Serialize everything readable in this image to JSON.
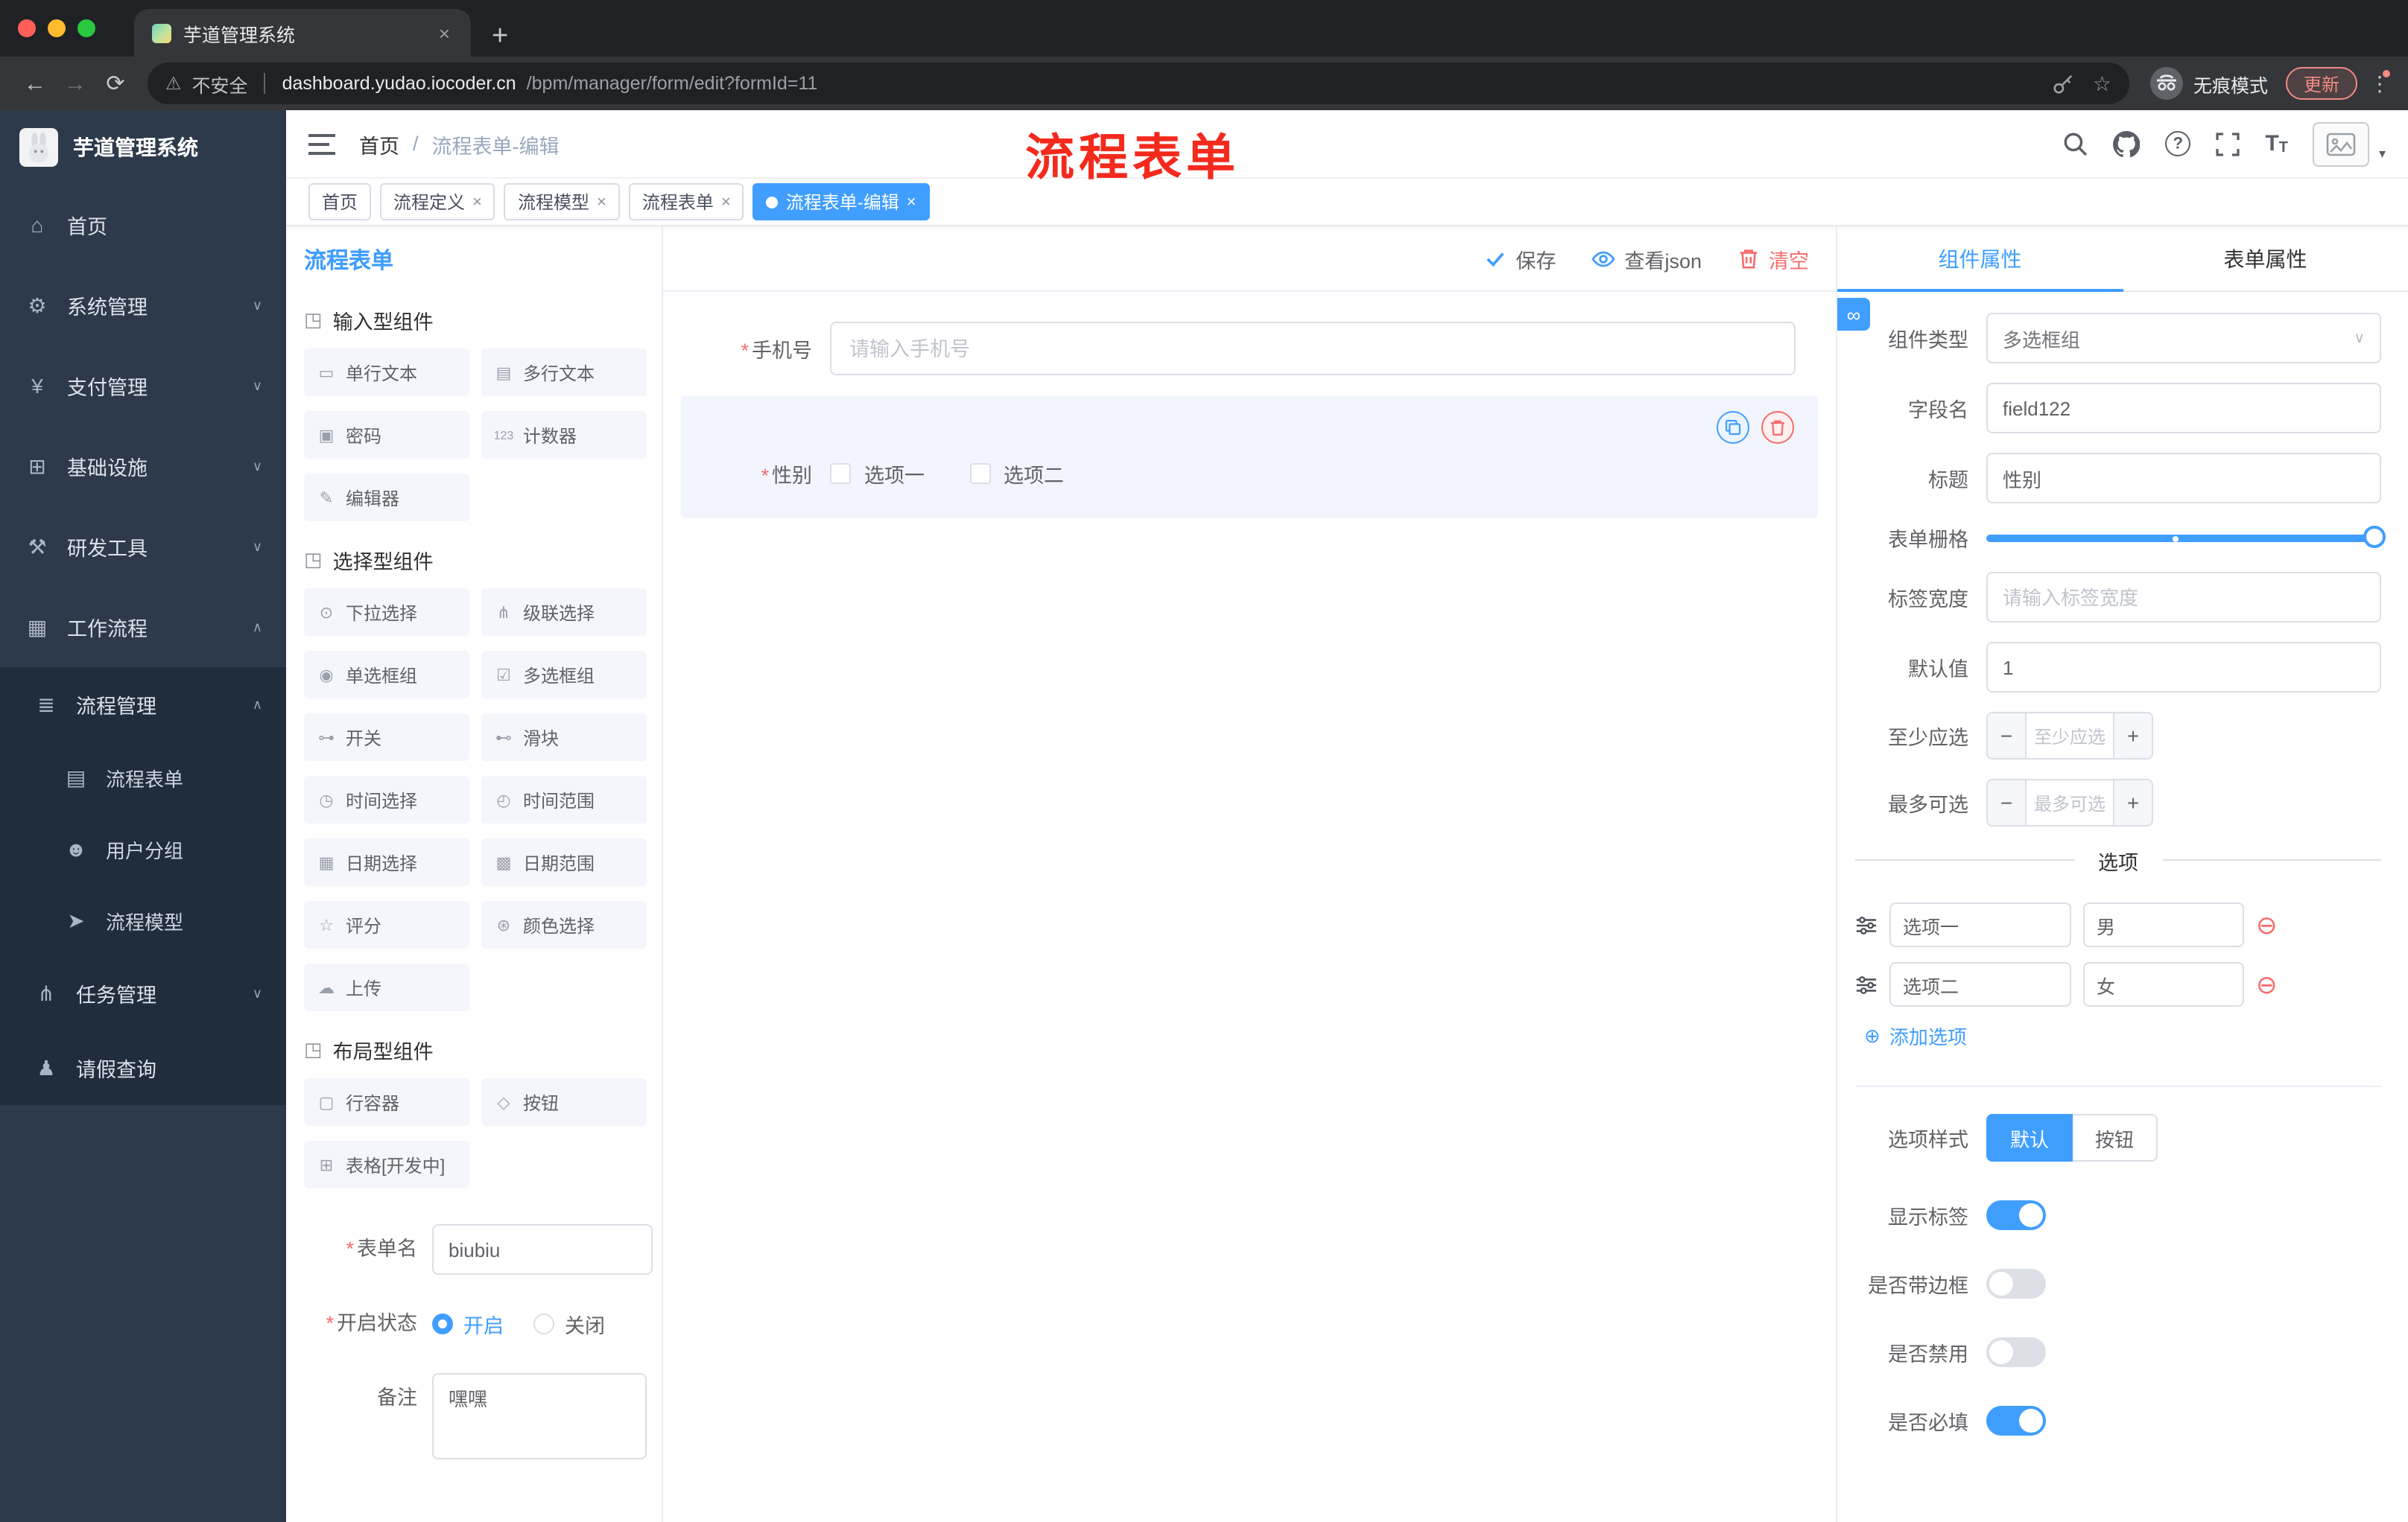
{
  "browser": {
    "tab_title": "芋道管理系统",
    "security_label": "不安全",
    "url_domain": "dashboard.yudao.iocoder.cn",
    "url_path": "/bpm/manager/form/edit?formId=11",
    "incognito_label": "无痕模式",
    "update_label": "更新"
  },
  "icons": {
    "back": "←",
    "forward": "→",
    "reload": "⟳",
    "warning": "⚠",
    "star": "☆",
    "plus": "+",
    "close": "×",
    "dot-menu": "⋮",
    "home": "⌂",
    "gear": "⚙",
    "yen": "¥",
    "infra": "⊞",
    "tools": "⚒",
    "workflow": "▦",
    "process-list": "≣",
    "doc": "▤",
    "chat": "☻",
    "send": "➤",
    "tree": "⋔",
    "person": "♟",
    "chevron-down": "∨",
    "chevron-up": "∧",
    "caret-down": "▾",
    "select-arrow": "∨",
    "group": "◳",
    "chip-single-line": "▭",
    "chip-multi-line": "▤",
    "chip-password": "▣",
    "chip-counter": "123",
    "chip-editor": "✎",
    "chip-select": "⊙",
    "chip-cascader": "⋔",
    "chip-radio": "◉",
    "chip-checkbox": "☑",
    "chip-switch": "⊶",
    "chip-slider": "⊷",
    "chip-time": "◷",
    "chip-time-range": "◴",
    "chip-date": "▦",
    "chip-date-range": "▩",
    "chip-rate": "☆",
    "chip-color": "⊛",
    "chip-upload": "☁",
    "chip-row": "▢",
    "chip-button": "◇",
    "chip-table": "⊞",
    "plus-circle": "⊕",
    "minus-circle": "⊖",
    "link": "∞"
  },
  "sidebar": {
    "logo_title": "芋道管理系统",
    "items": [
      {
        "label": "首页"
      },
      {
        "label": "系统管理"
      },
      {
        "label": "支付管理"
      },
      {
        "label": "基础设施"
      },
      {
        "label": "研发工具"
      },
      {
        "label": "工作流程"
      },
      {
        "label": "流程管理"
      },
      {
        "label": "流程表单"
      },
      {
        "label": "用户分组"
      },
      {
        "label": "流程模型"
      },
      {
        "label": "任务管理"
      },
      {
        "label": "请假查询"
      }
    ]
  },
  "header": {
    "breadcrumb_home": "首页",
    "breadcrumb_separator": "/",
    "breadcrumb_current": "流程表单-编辑",
    "annotation": "流程表单"
  },
  "tags": [
    {
      "label": "首页"
    },
    {
      "label": "流程定义"
    },
    {
      "label": "流程模型"
    },
    {
      "label": "流程表单"
    },
    {
      "label": "流程表单-编辑"
    }
  ],
  "designer": {
    "title": "流程表单",
    "save_label": "保存",
    "view_json_label": "查看json",
    "clear_label": "清空",
    "groups": [
      {
        "title": "输入型组件",
        "items": [
          "单行文本",
          "多行文本",
          "密码",
          "计数器",
          "编辑器"
        ]
      },
      {
        "title": "选择型组件",
        "items": [
          "下拉选择",
          "级联选择",
          "单选框组",
          "多选框组",
          "开关",
          "滑块",
          "时间选择",
          "时间范围",
          "日期选择",
          "日期范围",
          "评分",
          "颜色选择",
          "上传"
        ]
      },
      {
        "title": "布局型组件",
        "items": [
          "行容器",
          "按钮",
          "表格[开发中]"
        ]
      }
    ],
    "meta": {
      "form_name_label": "表单名",
      "form_name_value": "biubiu",
      "status_label": "开启状态",
      "status_on": "开启",
      "status_off": "关闭",
      "remark_label": "备注",
      "remark_value": "嘿嘿"
    }
  },
  "canvas": {
    "phone_label": "手机号",
    "phone_placeholder": "请输入手机号",
    "gender_label": "性别",
    "gender_option1": "选项一",
    "gender_option2": "选项二"
  },
  "props": {
    "tab_component": "组件属性",
    "tab_form": "表单属性",
    "component_type_label": "组件类型",
    "component_type_value": "多选框组",
    "field_name_label": "字段名",
    "field_name_value": "field122",
    "title_label": "标题",
    "title_value": "性别",
    "grid_label": "表单栅格",
    "label_width_label": "标签宽度",
    "label_width_placeholder": "请输入标签宽度",
    "default_label": "默认值",
    "default_value": "1",
    "min_label": "至少应选",
    "min_placeholder": "至少应选",
    "max_label": "最多可选",
    "max_placeholder": "最多可选",
    "options_title": "选项",
    "options": [
      {
        "label": "选项一",
        "value": "男"
      },
      {
        "label": "选项二",
        "value": "女"
      }
    ],
    "add_option_label": "添加选项",
    "style_label": "选项样式",
    "style_default": "默认",
    "style_button": "按钮",
    "switches": [
      {
        "label": "显示标签",
        "on": true
      },
      {
        "label": "是否带边框",
        "on": false
      },
      {
        "label": "是否禁用",
        "on": false
      },
      {
        "label": "是否必填",
        "on": true
      }
    ]
  },
  "colors": {
    "accent": "#409eff",
    "danger": "#f56c6c",
    "sidebar": "#2d3a4b",
    "sidebar_sub": "#1f2d3d",
    "annotation_red": "#f42a1d"
  }
}
